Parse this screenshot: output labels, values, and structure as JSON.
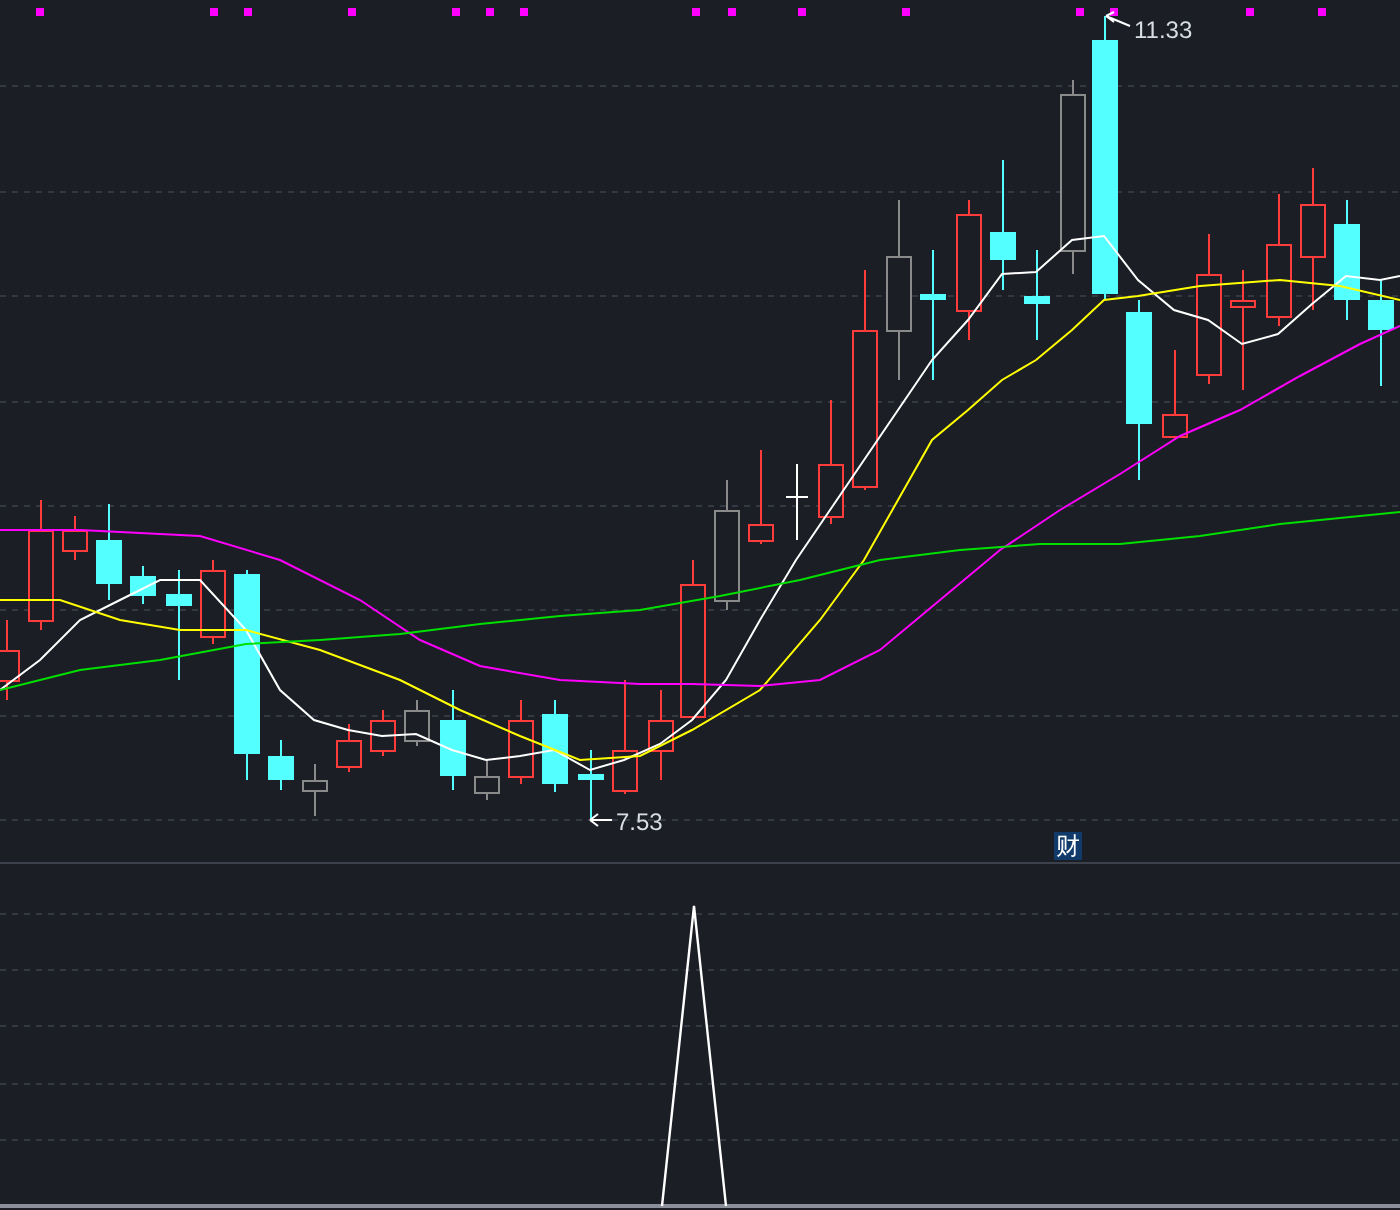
{
  "price_chart": {
    "high_label": "11.33",
    "low_label": "7.53"
  },
  "indicator_panel": {
    "label": "财"
  }
}
